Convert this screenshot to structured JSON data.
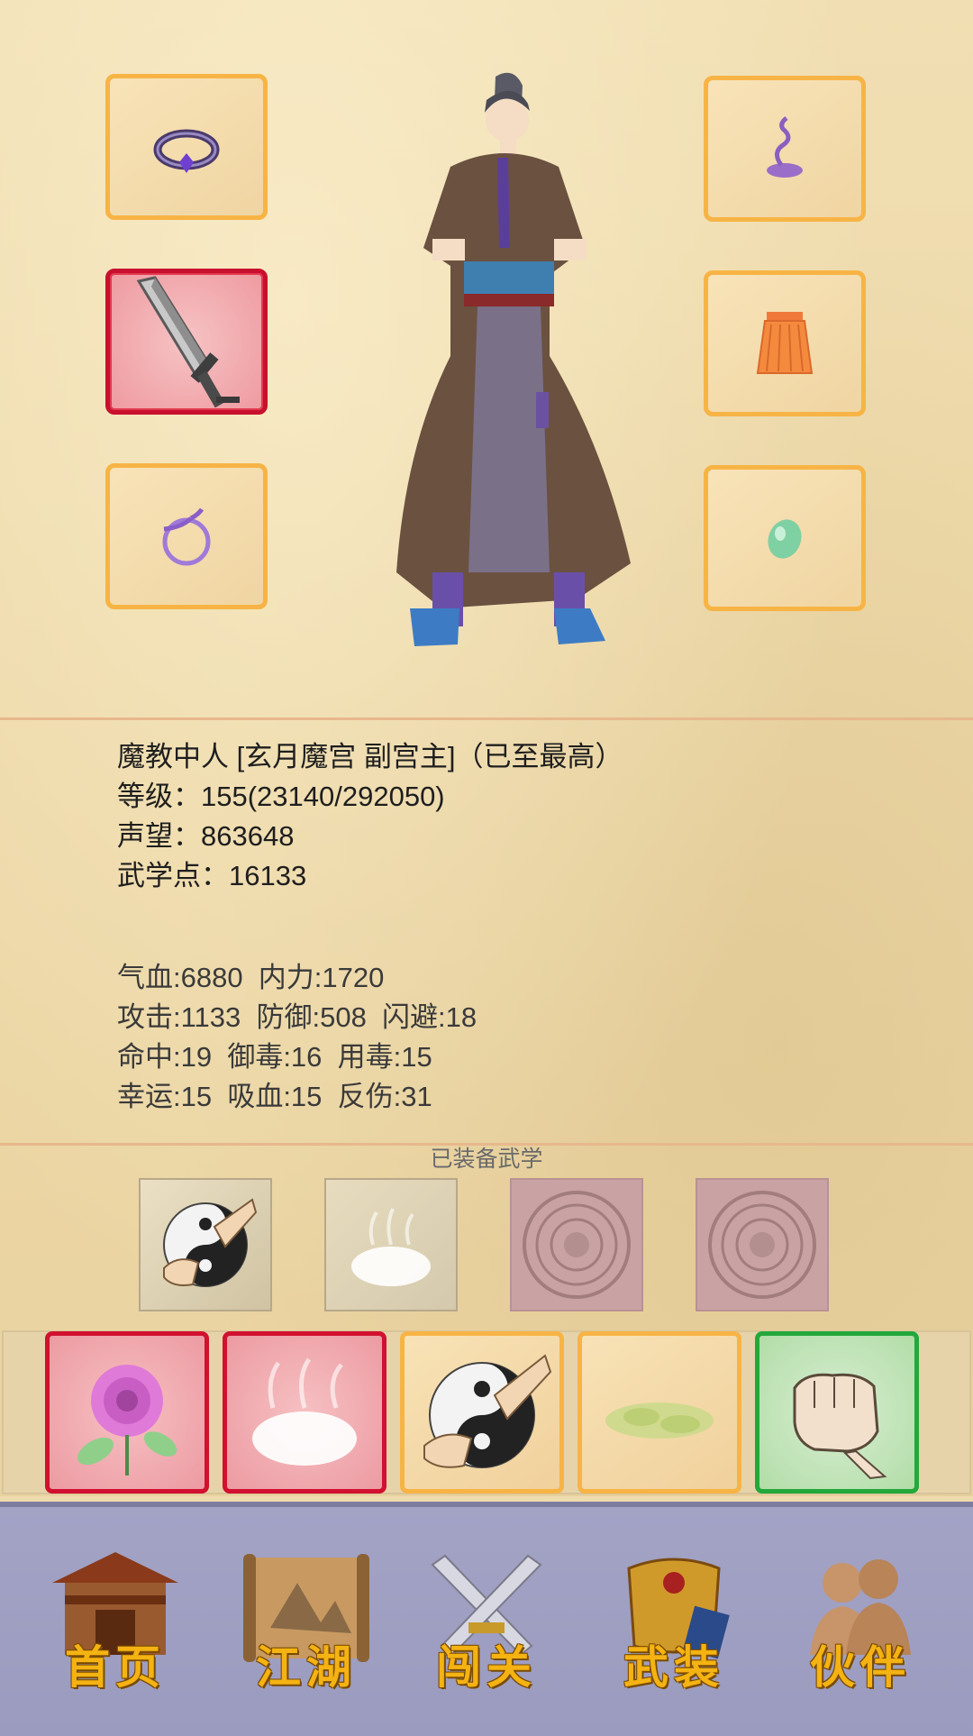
{
  "character": {
    "title_line": "魔教中人 [玄月魔宫 副宫主]（已至最高）",
    "level_line": "等级：155(23140/292050)",
    "reputation_line": "声望：863648",
    "martial_points_line": "武学点：16133"
  },
  "stats": {
    "row1": "气血:6880  内力:1720",
    "row2": "攻击:1133  防御:508  闪避:18",
    "row3": "命中:19  御毒:16  用毒:15",
    "row4": "幸运:15  吸血:15  反伤:31"
  },
  "equipment": {
    "left": [
      "ring-icon",
      "saber-icon",
      "charm-icon"
    ],
    "right": [
      "incense-icon",
      "armor-skirt-icon",
      "jade-icon"
    ]
  },
  "equipped_martial": {
    "title": "已装备武学",
    "slots": [
      "taiji-palm-icon",
      "mist-cloud-icon",
      "locked-slot-icon",
      "locked-slot-icon"
    ]
  },
  "skill_bar": [
    "rose-icon",
    "mist-cloud-icon",
    "taiji-palm-icon",
    "green-herb-icon",
    "fist-icon"
  ],
  "nav": {
    "home": "首页",
    "jianghu": "江湖",
    "chuangguan": "闯关",
    "wuzhuang": "武装",
    "huoban": "伙伴"
  },
  "colors": {
    "slot_border": "#f7b445",
    "rare_border": "#c8102e",
    "green_border": "#23a83b",
    "nav_label": "#f4b313",
    "nav_bg": "#9b9bbf"
  }
}
